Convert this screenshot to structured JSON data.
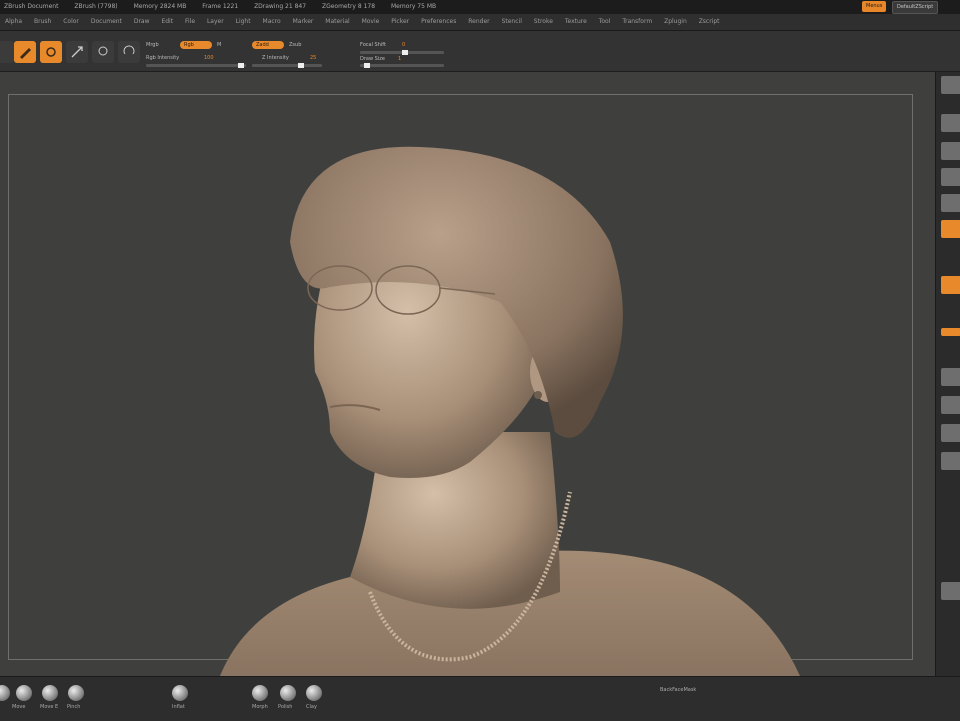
{
  "titlebar": {
    "app": "ZBrush Document",
    "items": [
      "ZBrush (7798)",
      "Memory 2824 MB",
      "Frame 1221",
      "ZDrawing 21 847",
      "ZGeometry 8 178",
      "Memory 75 MB"
    ]
  },
  "menubar": {
    "items": [
      "Alpha",
      "Brush",
      "Color",
      "Document",
      "Draw",
      "Edit",
      "File",
      "Layer",
      "Light",
      "Macro",
      "Marker",
      "Material",
      "Movie",
      "Picker",
      "Preferences",
      "Render",
      "Stencil",
      "Stroke",
      "Texture",
      "Tool",
      "Transform",
      "Zplugin",
      "Zscript"
    ]
  },
  "topright": {
    "menus": "Menus",
    "script": "DefaultZScript"
  },
  "toolbar": {
    "mrgb": "Mrgb",
    "rgb": "Rgb",
    "m": "M",
    "zadd": "Zadd",
    "zsub": "Zsub",
    "rgb_intensity": "Rgb Intensity",
    "rgb_intensity_val": "100",
    "z_intensity": "Z Intensity",
    "z_intensity_val": "25",
    "focal_shift": "Focal Shift",
    "focal_shift_val": "0",
    "draw_size": "Draw Size",
    "draw_size_val": "1"
  },
  "bottom": {
    "brushes": [
      "Move",
      "Move E",
      "Pinch",
      "Inflat",
      "Morph",
      "Polish",
      "Clay"
    ],
    "backface": "BackFaceMask"
  },
  "viewport": {
    "bg": "#3f403d",
    "accent": "#e88a2c"
  }
}
